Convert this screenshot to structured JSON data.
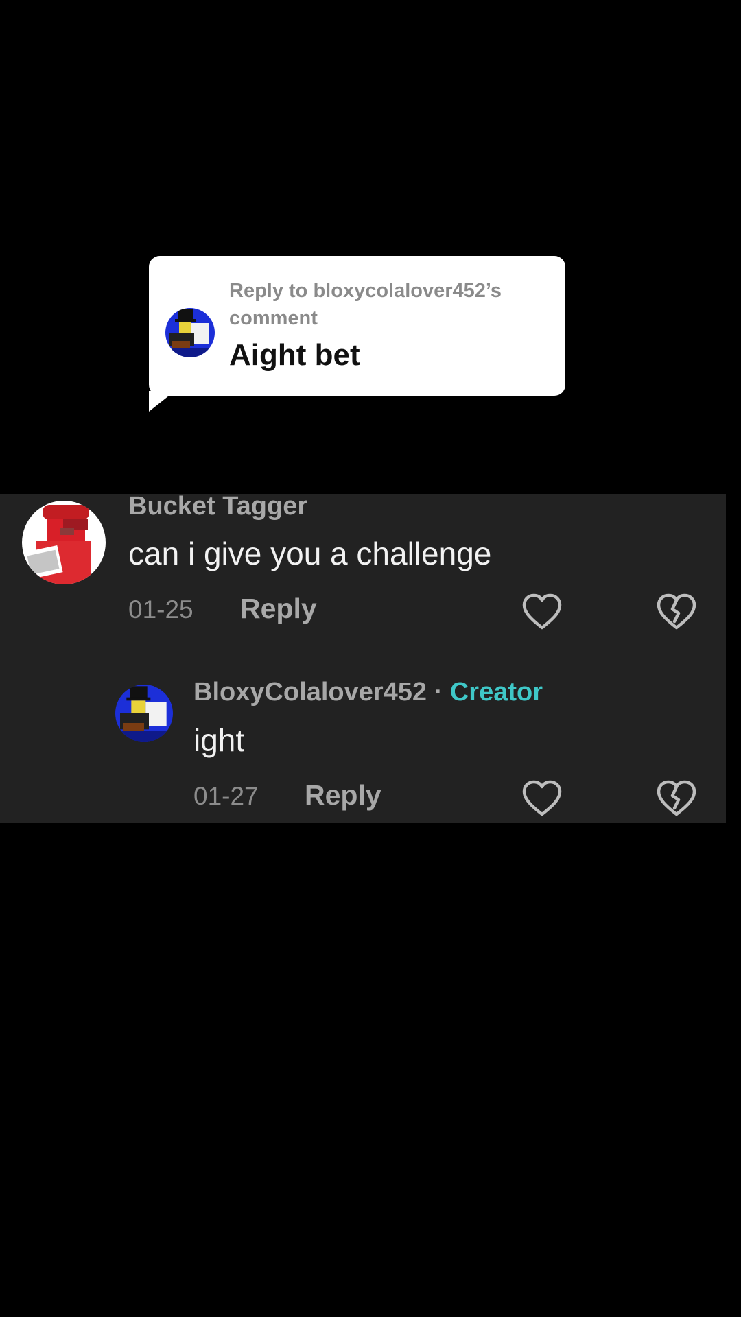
{
  "reply_card": {
    "heading": "Reply to bloxycolalover452’s comment",
    "text": "Aight bet"
  },
  "comments": [
    {
      "username": "Bucket Tagger",
      "text": "can i give you a challenge",
      "date": "01-25",
      "reply_label": "Reply"
    }
  ],
  "reply": {
    "username": "BloxyColalover452",
    "separator": "·",
    "badge": "Creator",
    "text": "ight",
    "date": "01-27",
    "reply_label": "Reply"
  },
  "colors": {
    "background": "#000000",
    "panel": "#222222",
    "creator_badge": "#3fc8c8"
  },
  "icons": {
    "like": "heart-outline-icon",
    "dislike": "broken-heart-icon"
  }
}
